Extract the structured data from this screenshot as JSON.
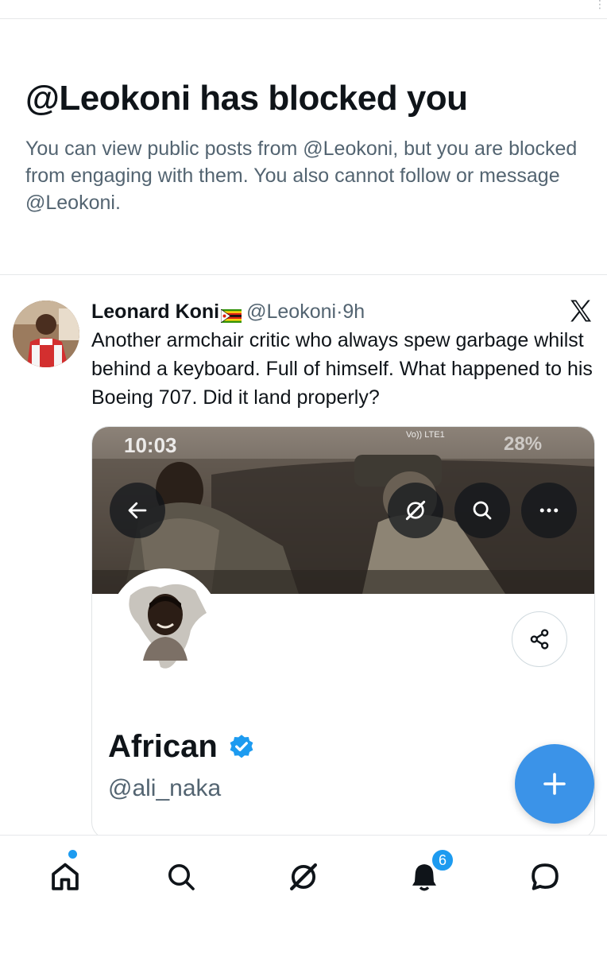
{
  "blocked_notice": {
    "title": "@Leokoni has blocked you",
    "message": "You can view public posts from @Leokoni, but you are blocked from engaging with them. You also cannot follow or message @Leokoni."
  },
  "post": {
    "author_name": "Leonard Koni",
    "author_flag": "zimbabwe-flag-emoji",
    "handle": "@Leokoni",
    "separator": "·",
    "time": "9h",
    "text": "Another armchair critic who always spew garbage whilst behind a keyboard. Full of himself. What happened to his Boeing 707. Did it land properly?",
    "embedded_screenshot": {
      "status_time": "10:03",
      "status_network": "Vo)) LTE1",
      "status_battery": "28%",
      "profile_name": "African",
      "profile_handle": "@ali_naka",
      "buttons": [
        "back-icon",
        "grok-icon",
        "search-icon",
        "more-icon",
        "share-icon"
      ]
    }
  },
  "fab": {
    "icon": "plus-icon"
  },
  "bottom_nav": {
    "items": [
      "home-icon",
      "search-icon",
      "grok-icon",
      "notifications-icon",
      "messages-icon"
    ],
    "notification_count": "6"
  },
  "colors": {
    "accent": "#1d9bf0",
    "fab": "#3b93e8",
    "text_primary": "#0f1419",
    "text_secondary": "#536471",
    "divider": "#e6e8ea"
  }
}
